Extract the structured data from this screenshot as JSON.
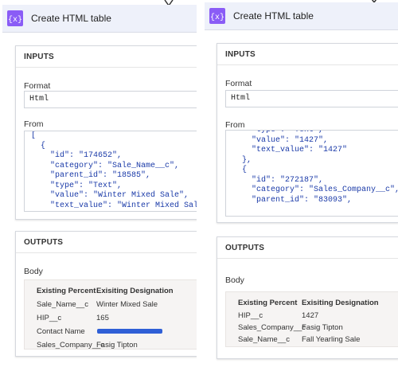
{
  "left": {
    "header": {
      "title": "Create HTML table",
      "icon": "variable-braces-icon"
    },
    "inputs": {
      "title": "INPUTS",
      "format_label": "Format",
      "format_value": "Html",
      "from_label": "From",
      "from_code": "[\n  {\n    \"id\": \"174652\",\n    \"category\": \"Sale_Name__c\",\n    \"parent_id\": \"18585\",\n    \"type\": \"Text\",\n    \"value\": \"Winter Mixed Sale\",\n    \"text_value\": \"Winter Mixed Sale\""
    },
    "outputs": {
      "title": "OUTPUTS",
      "body_label": "Body",
      "columns": [
        "Existing Percent",
        "Exisiting Designation"
      ],
      "rows": [
        [
          "Sale_Name__c",
          "Winter Mixed Sale"
        ],
        [
          "HIP__c",
          "165"
        ],
        [
          "Contact Name",
          ""
        ],
        [
          "Sales_Company__c",
          "Fasig Tipton"
        ]
      ]
    }
  },
  "right": {
    "header": {
      "title": "Create HTML table",
      "icon": "variable-braces-icon"
    },
    "inputs": {
      "title": "INPUTS",
      "format_label": "Format",
      "format_value": "Html",
      "from_label": "From",
      "from_code": "    \"type\": \"Text\",\n    \"value\": \"1427\",\n    \"text_value\": \"1427\"\n  },\n  {\n    \"id\": \"272187\",\n    \"category\": \"Sales_Company__c\",\n    \"parent_id\": \"83093\","
    },
    "outputs": {
      "title": "OUTPUTS",
      "body_label": "Body",
      "columns": [
        "Existing Percent",
        "Exisiting Designation"
      ],
      "rows": [
        [
          "HIP__c",
          "1427"
        ],
        [
          "Sales_Company__c",
          "Fasig Tipton"
        ],
        [
          "Sale_Name__c",
          "Fall Yearling Sale"
        ]
      ]
    }
  },
  "colors": {
    "icon_bg": "#8a5cf6",
    "header_bg": "#eef1fa",
    "code_text": "#1a3aa8",
    "redaction": "#2f5fd6"
  }
}
